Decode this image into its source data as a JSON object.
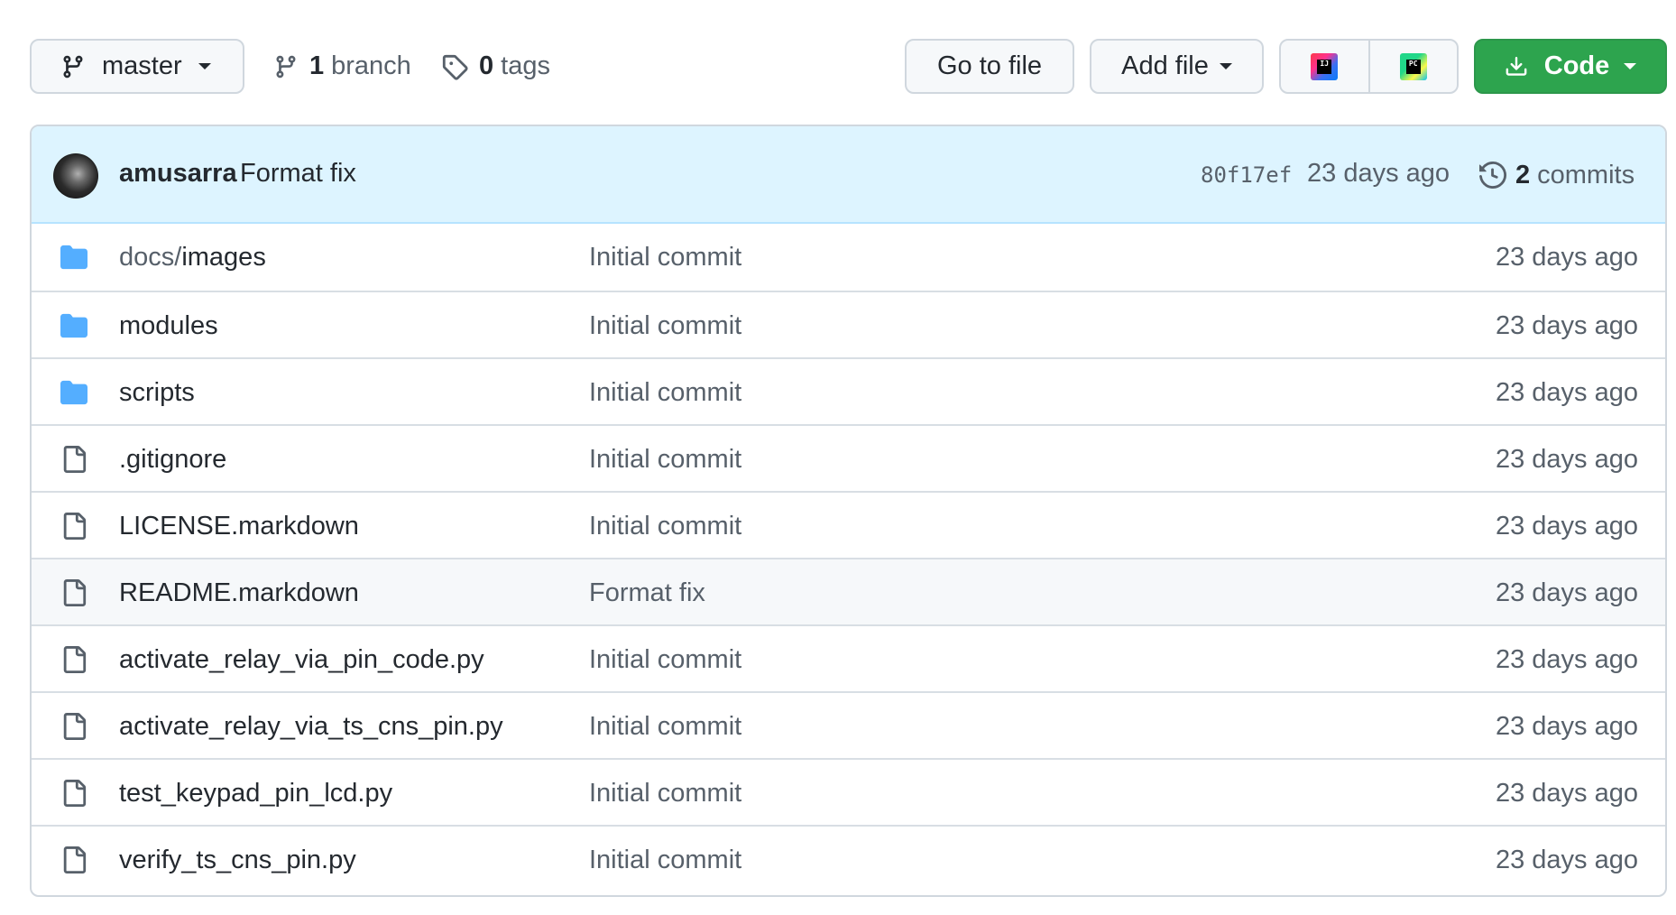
{
  "toolbar": {
    "branch_name": "master",
    "branches_count": "1",
    "branches_word": "branch",
    "tags_count": "0",
    "tags_word": "tags",
    "go_to_file": "Go to file",
    "add_file": "Add file",
    "ide1_label": "IJ",
    "ide2_label": "PC",
    "code": "Code",
    "code_color": "#2da44e"
  },
  "commit": {
    "author": "amusarra",
    "message": "Format fix",
    "sha": "80f17ef",
    "time": "23 days ago",
    "commits_count": "2",
    "commits_word": "commits"
  },
  "files": [
    {
      "type": "dir",
      "prefix": "docs/",
      "name": "images",
      "message": "Initial commit",
      "age": "23 days ago"
    },
    {
      "type": "dir",
      "prefix": "",
      "name": "modules",
      "message": "Initial commit",
      "age": "23 days ago"
    },
    {
      "type": "dir",
      "prefix": "",
      "name": "scripts",
      "message": "Initial commit",
      "age": "23 days ago"
    },
    {
      "type": "file",
      "prefix": "",
      "name": ".gitignore",
      "message": "Initial commit",
      "age": "23 days ago"
    },
    {
      "type": "file",
      "prefix": "",
      "name": "LICENSE.markdown",
      "message": "Initial commit",
      "age": "23 days ago"
    },
    {
      "type": "file",
      "prefix": "",
      "name": "README.markdown",
      "message": "Format fix",
      "age": "23 days ago"
    },
    {
      "type": "file",
      "prefix": "",
      "name": "activate_relay_via_pin_code.py",
      "message": "Initial commit",
      "age": "23 days ago"
    },
    {
      "type": "file",
      "prefix": "",
      "name": "activate_relay_via_ts_cns_pin.py",
      "message": "Initial commit",
      "age": "23 days ago"
    },
    {
      "type": "file",
      "prefix": "",
      "name": "test_keypad_pin_lcd.py",
      "message": "Initial commit",
      "age": "23 days ago"
    },
    {
      "type": "file",
      "prefix": "",
      "name": "verify_ts_cns_pin.py",
      "message": "Initial commit",
      "age": "23 days ago"
    }
  ]
}
